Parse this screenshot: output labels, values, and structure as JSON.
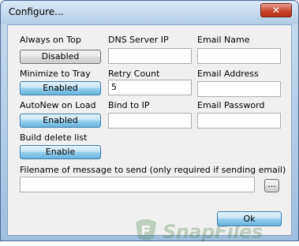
{
  "window": {
    "title": "Configure...",
    "close_glyph": "✕"
  },
  "settings": {
    "always_on_top": {
      "label": "Always on Top",
      "button": "Disabled"
    },
    "minimize_to_tray": {
      "label": "Minimize to Tray",
      "button": "Enabled"
    },
    "autonew_on_load": {
      "label": "AutoNew on Load",
      "button": "Enabled"
    },
    "build_delete_list": {
      "label": "Build delete list",
      "button": "Enable"
    }
  },
  "fields": {
    "dns_server_ip": {
      "label": "DNS Server IP",
      "value": ""
    },
    "retry_count": {
      "label": "Retry Count",
      "value": "5"
    },
    "bind_to_ip": {
      "label": "Bind to IP",
      "value": ""
    },
    "email_name": {
      "label": "Email Name",
      "value": ""
    },
    "email_address": {
      "label": "Email Address",
      "value": ""
    },
    "email_password": {
      "label": "Email Password",
      "value": ""
    },
    "message_file": {
      "label": "Filename of message to send (only required if sending email)",
      "value": "",
      "browse": "..."
    }
  },
  "actions": {
    "ok": "Ok"
  },
  "watermark": {
    "text": "SnapFiles"
  },
  "colors": {
    "enabled_button": "#98d1ef",
    "disabled_button": "#dddddd",
    "watermark": "#3d7a3a"
  }
}
